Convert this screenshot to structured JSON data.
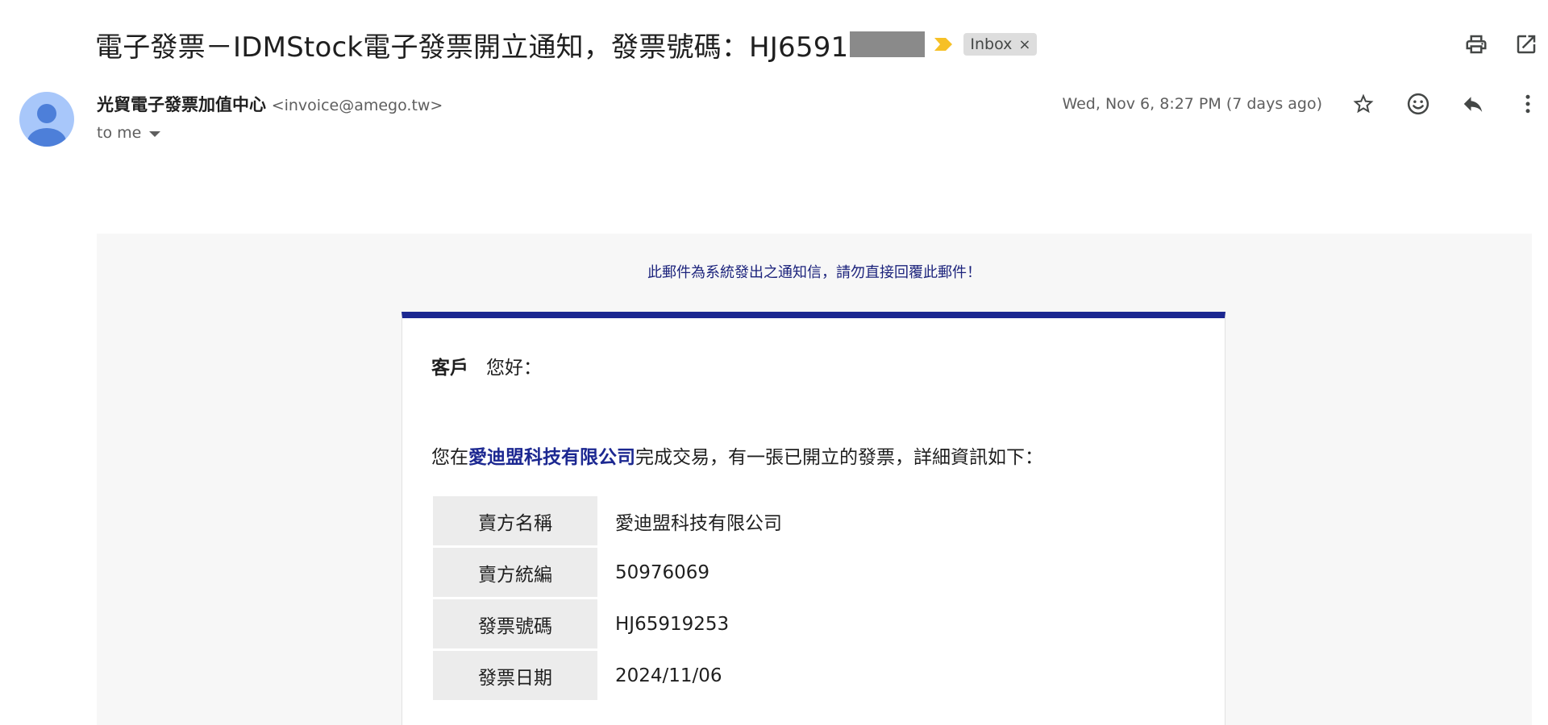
{
  "email": {
    "subject": "電子發票－IDMStock電子發票開立通知，發票號碼：HJ6591",
    "label": "Inbox",
    "sender_name": "光貿電子發票加值中心",
    "sender_email": "<invoice@amego.tw>",
    "recipient": "to me",
    "date": "Wed, Nov 6, 8:27 PM (7 days ago)"
  },
  "icons": {
    "importance": "importance-marker-icon",
    "print": "print-icon",
    "open_new_window": "open-in-new-window-icon",
    "star": "star-icon",
    "emoji": "emoji-reaction-icon",
    "reply": "reply-icon",
    "more": "more-vert-icon",
    "avatar": "person-avatar-icon"
  },
  "colors": {
    "accent_navy": "#1c2891",
    "importance_yellow": "#f6c026",
    "avatar_bg": "#a8c7fa",
    "avatar_fg": "#4d7fd9"
  },
  "body": {
    "notice": "此郵件為系統發出之通知信，請勿直接回覆此郵件！",
    "greeting_name": "客戶",
    "greeting_text": "您好：",
    "intro_prefix": "您在",
    "intro_company": "愛迪盟科技有限公司",
    "intro_suffix": "完成交易，有一張已開立的發票，詳細資訊如下：",
    "rows": [
      {
        "key": "賣方名稱",
        "value": "愛迪盟科技有限公司"
      },
      {
        "key": "賣方統編",
        "value": "50976069"
      },
      {
        "key": "發票號碼",
        "value": "HJ65919253"
      },
      {
        "key": "發票日期",
        "value": "2024/11/06"
      }
    ]
  }
}
